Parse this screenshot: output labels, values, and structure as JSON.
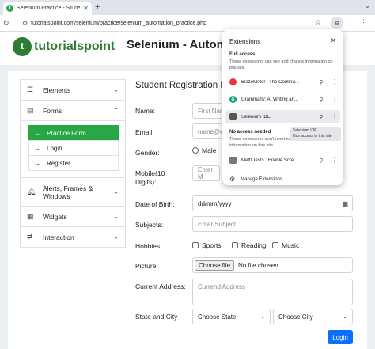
{
  "browser": {
    "tab_title": "Selenium Practice - Student I",
    "tab_favicon": "f",
    "url": "tutorialspoint.com/selenium/practice/selenium_automation_practice.php"
  },
  "header": {
    "logo_mark": "t",
    "logo_text": "tutorialspoint",
    "title": "Selenium - Automation"
  },
  "sidebar": {
    "elements": "Elements",
    "forms": "Forms",
    "forms_items": [
      "Practice Form",
      "Login",
      "Register"
    ],
    "alerts": "Alerts, Frames & Windows",
    "widgets": "Widgets",
    "interaction": "Interaction"
  },
  "form": {
    "title": "Student Registration Fo",
    "name_label": "Name:",
    "name_placeholder": "First Nam",
    "email_label": "Email:",
    "email_placeholder": "name@e",
    "gender_label": "Gender:",
    "gender_male": "Male",
    "mobile_label": "Mobile(10 Digits):",
    "mobile_placeholder": "Enter M",
    "dob_label": "Date of Birth:",
    "dob_value": "dd/mm/yyyy",
    "subjects_label": "Subjects:",
    "subjects_placeholder": "Enter Subject",
    "hobbies_label": "Hobbies:",
    "hobbies": [
      "Sports",
      "Reading",
      "Music"
    ],
    "picture_label": "Picture:",
    "choose_file": "Choose file",
    "no_file": "No file chosen",
    "address_label": "Current Address:",
    "address_placeholder": "Currend Address",
    "state_city_label": "State and City",
    "state_placeholder": "Choose State",
    "city_placeholder": "Choose City",
    "login_button": "Login"
  },
  "extensions": {
    "title": "Extensions",
    "full_access": "Full access",
    "full_access_desc": "These extensions can see and change information on this site.",
    "items_full": [
      {
        "name": "BlazeMeter | The Continu...",
        "color": "#e53935"
      },
      {
        "name": "Grammarly: AI Writing an...",
        "color": "#15a37f"
      },
      {
        "name": "Selenium IDE",
        "color": "#555555"
      }
    ],
    "no_access": "No access needed",
    "no_access_desc": "These extensions don't need to see and change information on this site.",
    "items_none": [
      {
        "name": "Mettl Tests : Enable Scre...",
        "color": "#777777"
      }
    ],
    "manage": "Manage Extensions",
    "tooltip_title": "Selenium IDE",
    "tooltip_desc": "Has access to this site"
  }
}
